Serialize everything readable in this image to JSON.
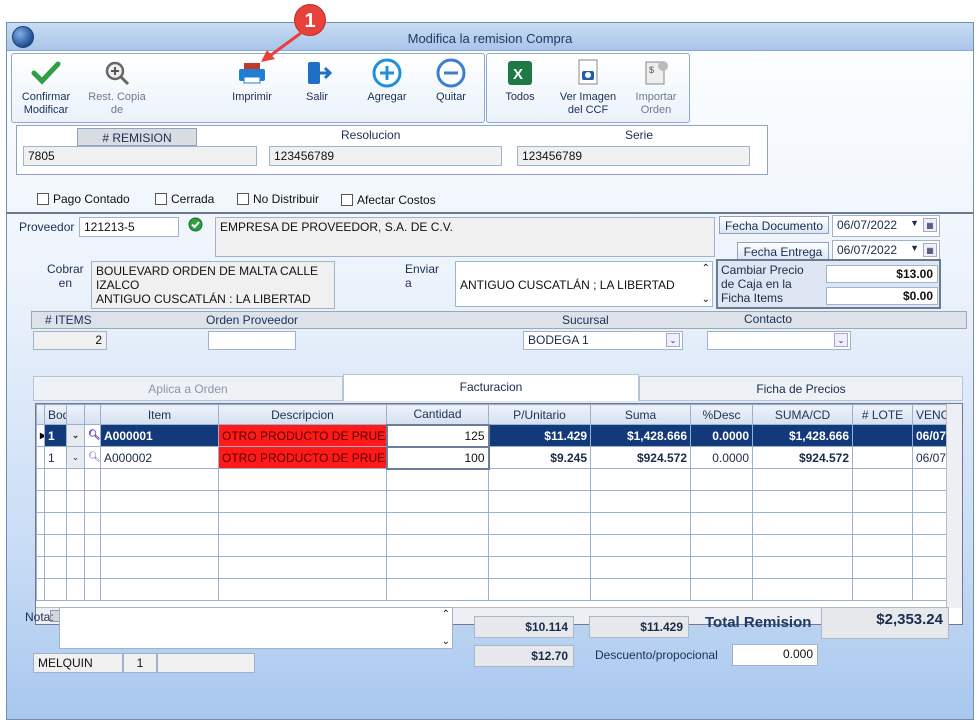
{
  "window": {
    "title": "Modifica la remision Compra"
  },
  "toolbar": {
    "confirmar": "Confirmar\nModificar",
    "rest_copia": "Rest. Copia\nde",
    "imprimir": "Imprimir",
    "salir": "Salir",
    "agregar": "Agregar",
    "quitar": "Quitar",
    "todos": "Todos",
    "ver_imagen": "Ver Imagen\ndel CCF",
    "importar": "Importar\nOrden"
  },
  "header": {
    "remision_label": "# REMISION",
    "remision_value": "7805",
    "resolucion_label": "Resolucion",
    "resolucion_value": "123456789",
    "serie_label": "Serie",
    "serie_value": "123456789"
  },
  "checks": {
    "pago": "Pago Contado",
    "cerrada": "Cerrada",
    "no_distribuir": "No Distribuir",
    "afectar": "Afectar Costos"
  },
  "proveedor": {
    "label": "Proveedor",
    "code": "121213-5",
    "name": "EMPRESA DE PROVEEDOR, S.A. DE C.V."
  },
  "fechas": {
    "doc_label": "Fecha Documento",
    "doc_value": "06/07/2022",
    "ent_label": "Fecha Entrega",
    "ent_value": "06/07/2022"
  },
  "cobrar": {
    "label1": "Cobrar",
    "label2": "en",
    "l1": "BOULEVARD ORDEN DE MALTA CALLE",
    "l2": "IZALCO",
    "l3": "ANTIGUO CUSCATLÁN : LA LIBERTAD"
  },
  "enviar": {
    "label1": "Enviar",
    "label2": "a",
    "value": "ANTIGUO CUSCATLÁN ; LA LIBERTAD"
  },
  "precio": {
    "label": "Cambiar Precio\nde Caja en la\nFicha Items",
    "v1": "$13.00",
    "v2": "$0.00"
  },
  "items_bar": {
    "items_label": "# ITEMS",
    "items_value": "2",
    "orden_label": "Orden Proveedor",
    "sucursal_label": "Sucursal",
    "sucursal_value": "BODEGA 1",
    "contacto_label": "Contacto"
  },
  "tabs": {
    "aplica": "Aplica a Orden",
    "facturacion": "Facturacion",
    "ficha": "Ficha de Precios"
  },
  "grid": {
    "headers": [
      "Bodega",
      "",
      "",
      "Item",
      "Descripcion",
      "Cantidad",
      "P/Unitario",
      "Suma",
      "%Desc",
      "SUMA/CD",
      "# LOTE",
      "VENC"
    ],
    "rows": [
      {
        "bodega": "1",
        "item": "A000001",
        "desc": "OTRO PRODUCTO DE PRUEBA",
        "cantidad": "125",
        "punit": "$11.429",
        "suma": "$1,428.666",
        "desc_pct": "0.0000",
        "sumacd": "$1,428.666",
        "lote": "",
        "venc": "06/07"
      },
      {
        "bodega": "1",
        "item": "A000002",
        "desc": "OTRO PRODUCTO DE PRUEBA",
        "cantidad": "100",
        "punit": "$9.245",
        "suma": "$924.572",
        "desc_pct": "0.0000",
        "sumacd": "$924.572",
        "lote": "",
        "venc": "06/07"
      }
    ]
  },
  "footer": {
    "nota_label": "Nota:",
    "user": "MELQUIN",
    "user_num": "1",
    "s1": "$10.114",
    "s2": "$11.429",
    "s3": "$12.70",
    "total_label": "Total Remision",
    "total_value": "$2,353.24",
    "descuento_label": "Descuento/propocional",
    "descuento_value": "0.000"
  },
  "callout": "1"
}
